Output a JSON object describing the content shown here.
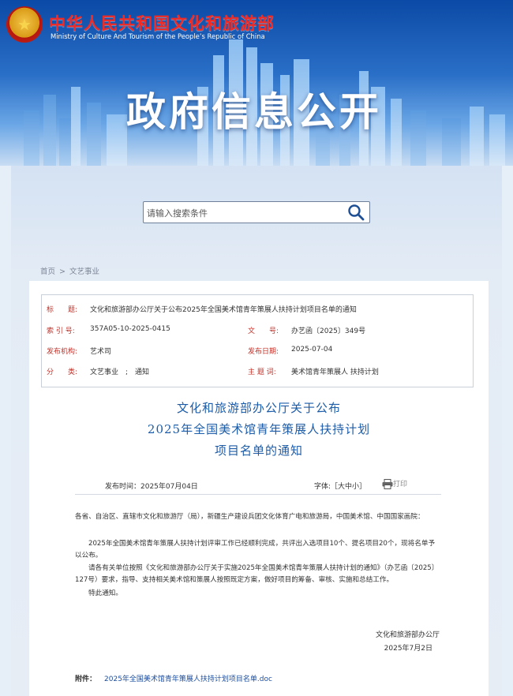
{
  "header": {
    "ministry_cn": "中华人民共和国文化和旅游部",
    "ministry_en": "Ministry of Culture And Tourism of the People’s Republic of China",
    "section_title": "政府信息公开"
  },
  "search": {
    "placeholder": "请输入搜索条件"
  },
  "breadcrumb": {
    "home": "首页",
    "separator": ">",
    "current": "文艺事业"
  },
  "meta": {
    "title_label": "标　　题:",
    "title_value": "文化和旅游部办公厅关于公布2025年全国美术馆青年策展人扶持计划项目名单的通知",
    "index_label": "索 引 号:",
    "index_value": "357A05-10-2025-0415",
    "docno_label": "文　　号:",
    "docno_value": "办艺函〔2025〕349号",
    "issuer_label": "发布机构:",
    "issuer_value": "艺术司",
    "date_label": "发布日期:",
    "date_value": "2025-07-04",
    "category_label": "分　　类:",
    "category_value": "文艺事业　;　通知",
    "topic_label": "主 题 词:",
    "topic_value": "美术馆青年策展人 扶持计划"
  },
  "document": {
    "title_line1": "文化和旅游部办公厅关于公布",
    "title_line2": "2025年全国美术馆青年策展人扶持计划",
    "title_line3": "项目名单的通知",
    "publish_time": "发布时间：2025年07月04日",
    "font_size": "字体:［大中小］",
    "print": "打印",
    "para1": "各省、自治区、直辖市文化和旅游厅（局），新疆生产建设兵团文化体育广电和旅游局，中国美术馆、中国国家画院：",
    "para2": "2025年全国美术馆青年策展人扶持计划评审工作已经顺利完成，共评出入选项目10个、提名项目20个，现将名单予以公布。",
    "para3": "请各有关单位按照《文化和旅游部办公厅关于实施2025年全国美术馆青年策展人扶持计划的通知》（办艺函〔2025〕127号）要求，指导、支持相关美术馆和策展人按照既定方案，做好项目的筹备、审核、实施和总结工作。",
    "para4": "特此通知。",
    "sign_org": "文化和旅游部办公厅",
    "sign_date": "2025年7月2日",
    "attach_label": "附件：",
    "attach_file": "2025年全国美术馆青年策展人扶持计划项目名单.doc"
  },
  "colors": {
    "brand_red": "#f12a23",
    "label_red": "#c2322a",
    "title_blue": "#1d5ca8",
    "link_blue": "#1b4ea0"
  }
}
